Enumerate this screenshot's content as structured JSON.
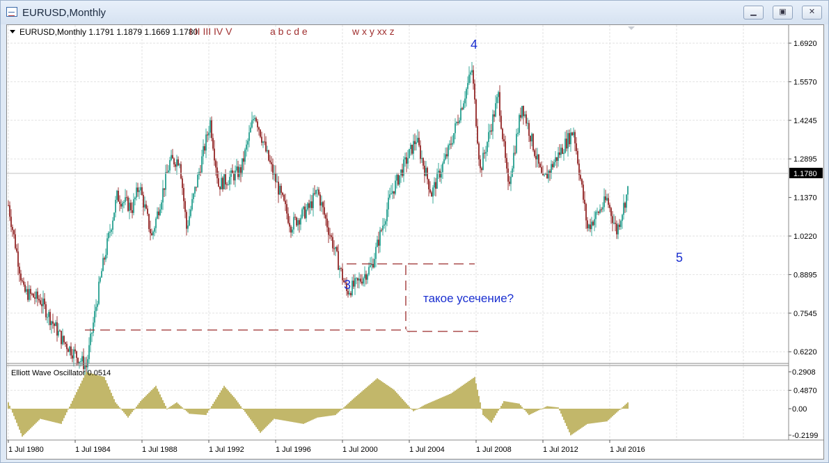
{
  "window": {
    "title": "EURUSD,Monthly",
    "icon": "chart-window-icon",
    "controls": [
      "minimize-icon",
      "restore-icon",
      "close-icon"
    ]
  },
  "header": {
    "symbol_label": "EURUSD,Monthly  1.1791 1.1879 1.1669 1.1780",
    "wave_labels_1": "I II III IV V",
    "wave_labels_2": "a b c d e",
    "wave_labels_3": "w x y xx z"
  },
  "annotations": {
    "wave_3": "3",
    "wave_4": "4",
    "wave_5": "5",
    "question": "такое усечение?"
  },
  "oscillator": {
    "label": "Elliott Wave Oscillator 0.0514"
  },
  "price_axis": {
    "ticks": [
      "1.6920",
      "1.5570",
      "1.4245",
      "1.2895",
      "1.1370",
      "1.0220",
      "0.8895",
      "0.7545",
      "0.6220",
      "0.4870"
    ],
    "current_price": "1.1780"
  },
  "osc_axis": {
    "ticks": [
      "0.2908",
      "0.00",
      "-0.2199"
    ]
  },
  "time_axis": {
    "ticks": [
      "1 Jul 1980",
      "1 Jul 1984",
      "1 Jul 1988",
      "1 Jul 1992",
      "1 Jul 1996",
      "1 Jul 2000",
      "1 Jul 2004",
      "1 Jul 2008",
      "1 Jul 2012",
      "1 Jul 2016"
    ]
  },
  "colors": {
    "bull": "#3aa89a",
    "bear": "#9c3a3a",
    "osc": "#c2b76a",
    "wave_numbers": "#1a2fd0",
    "wave_letters": "#a03030",
    "current_price_bg": "#000000"
  },
  "chart_data": {
    "type": "candlestick",
    "symbol": "EURUSD",
    "timeframe": "Monthly",
    "ylim": [
      0.487,
      1.692
    ],
    "last": {
      "open": 1.1791,
      "high": 1.1879,
      "low": 1.1669,
      "close": 1.178
    },
    "price_path": [
      {
        "x": "1980-07",
        "y": 1.13
      },
      {
        "x": "1981-06",
        "y": 0.83
      },
      {
        "x": "1982-06",
        "y": 0.8
      },
      {
        "x": "1983-10",
        "y": 0.66
      },
      {
        "x": "1985-03",
        "y": 0.57
      },
      {
        "x": "1986-02",
        "y": 0.9
      },
      {
        "x": "1987-01",
        "y": 1.16
      },
      {
        "x": "1987-12",
        "y": 1.12
      },
      {
        "x": "1988-05",
        "y": 1.2
      },
      {
        "x": "1989-02",
        "y": 1.02
      },
      {
        "x": "1990-03",
        "y": 1.28
      },
      {
        "x": "1990-10",
        "y": 1.29
      },
      {
        "x": "1991-03",
        "y": 1.05
      },
      {
        "x": "1992-08",
        "y": 1.42
      },
      {
        "x": "1993-02",
        "y": 1.2
      },
      {
        "x": "1994-06",
        "y": 1.25
      },
      {
        "x": "1995-04",
        "y": 1.45
      },
      {
        "x": "1996-01",
        "y": 1.3
      },
      {
        "x": "1997-06",
        "y": 1.06
      },
      {
        "x": "1998-07",
        "y": 1.12
      },
      {
        "x": "1999-01",
        "y": 1.18
      },
      {
        "x": "2000-10",
        "y": 0.83
      },
      {
        "x": "2001-06",
        "y": 0.86
      },
      {
        "x": "2002-04",
        "y": 0.92
      },
      {
        "x": "2003-06",
        "y": 1.17
      },
      {
        "x": "2004-12",
        "y": 1.36
      },
      {
        "x": "2005-11",
        "y": 1.17
      },
      {
        "x": "2006-12",
        "y": 1.33
      },
      {
        "x": "2008-04",
        "y": 1.6
      },
      {
        "x": "2008-10",
        "y": 1.25
      },
      {
        "x": "2009-11",
        "y": 1.51
      },
      {
        "x": "2010-06",
        "y": 1.19
      },
      {
        "x": "2011-04",
        "y": 1.48
      },
      {
        "x": "2012-07",
        "y": 1.21
      },
      {
        "x": "2013-03",
        "y": 1.28
      },
      {
        "x": "2014-05",
        "y": 1.39
      },
      {
        "x": "2015-03",
        "y": 1.05
      },
      {
        "x": "2016-05",
        "y": 1.15
      },
      {
        "x": "2016-12",
        "y": 1.04
      },
      {
        "x": "2017-08",
        "y": 1.18
      }
    ],
    "oscillator_path": [
      {
        "x": "1980-07",
        "y": 0.05
      },
      {
        "x": "1981-05",
        "y": -0.22
      },
      {
        "x": "1982-06",
        "y": -0.08
      },
      {
        "x": "1983-09",
        "y": -0.12
      },
      {
        "x": "1985-03",
        "y": 0.29
      },
      {
        "x": "1986-04",
        "y": 0.25
      },
      {
        "x": "1986-12",
        "y": 0.05
      },
      {
        "x": "1987-09",
        "y": -0.07
      },
      {
        "x": "1988-06",
        "y": 0.06
      },
      {
        "x": "1989-05",
        "y": 0.18
      },
      {
        "x": "1990-01",
        "y": 0.0
      },
      {
        "x": "1990-08",
        "y": 0.05
      },
      {
        "x": "1991-05",
        "y": -0.04
      },
      {
        "x": "1992-05",
        "y": -0.05
      },
      {
        "x": "1993-06",
        "y": 0.18
      },
      {
        "x": "1994-02",
        "y": 0.08
      },
      {
        "x": "1995-08",
        "y": -0.19
      },
      {
        "x": "1996-06",
        "y": -0.08
      },
      {
        "x": "1998-03",
        "y": -0.12
      },
      {
        "x": "1999-01",
        "y": -0.07
      },
      {
        "x": "2000-02",
        "y": -0.05
      },
      {
        "x": "2001-03",
        "y": 0.08
      },
      {
        "x": "2002-08",
        "y": 0.24
      },
      {
        "x": "2003-08",
        "y": 0.15
      },
      {
        "x": "2004-10",
        "y": -0.02
      },
      {
        "x": "2005-06",
        "y": 0.03
      },
      {
        "x": "2007-01",
        "y": 0.12
      },
      {
        "x": "2008-06",
        "y": 0.25
      },
      {
        "x": "2008-12",
        "y": -0.05
      },
      {
        "x": "2009-06",
        "y": -0.11
      },
      {
        "x": "2010-03",
        "y": 0.06
      },
      {
        "x": "2011-02",
        "y": 0.04
      },
      {
        "x": "2011-09",
        "y": -0.05
      },
      {
        "x": "2012-10",
        "y": 0.02
      },
      {
        "x": "2013-06",
        "y": 0.01
      },
      {
        "x": "2014-03",
        "y": -0.21
      },
      {
        "x": "2015-03",
        "y": -0.12
      },
      {
        "x": "2016-05",
        "y": -0.1
      },
      {
        "x": "2017-08",
        "y": 0.05
      }
    ]
  }
}
